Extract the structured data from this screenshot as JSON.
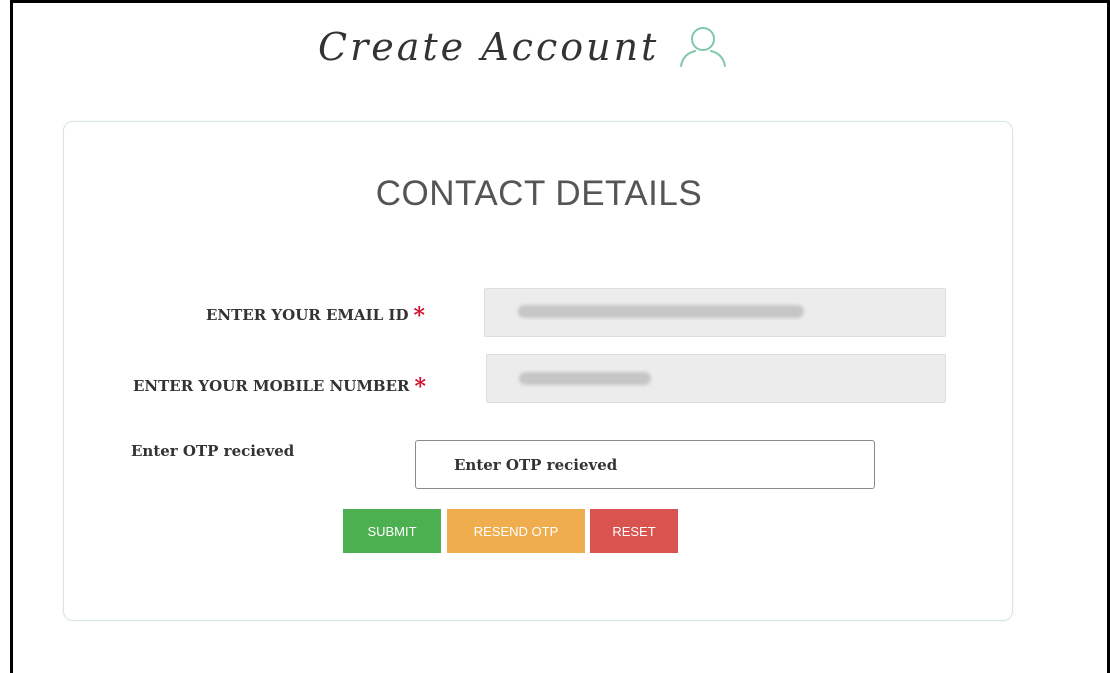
{
  "heading": {
    "title": "Create Account",
    "icon": "user-icon"
  },
  "section": {
    "title": "CONTACT DETAILS"
  },
  "form": {
    "email": {
      "label": "ENTER YOUR EMAIL ID",
      "required_mark": "*",
      "value_redacted": true
    },
    "mobile": {
      "label": "ENTER YOUR MOBILE NUMBER",
      "required_mark": "*",
      "value_redacted": true
    },
    "otp": {
      "label": "Enter OTP recieved",
      "placeholder": "Enter OTP recieved"
    }
  },
  "buttons": {
    "submit": "SUBMIT",
    "resend": "RESEND OTP",
    "reset": "RESET"
  },
  "colors": {
    "submit": "#4caf50",
    "resend": "#f0ad4e",
    "reset": "#d9534f",
    "required": "#d0112b",
    "icon": "#7fc8a9"
  }
}
